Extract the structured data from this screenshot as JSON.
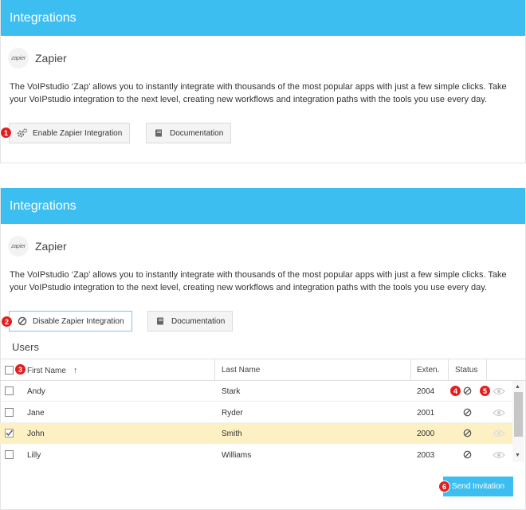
{
  "sections": [
    {
      "header": "Integrations",
      "zapier_logo": "zapier",
      "zapier_name": "Zapier",
      "description": "The VoIPstudio ‘Zap’ allows you to instantly integrate with thousands of the most popular apps with just a few simple clicks. Take your VoIPstudio integration to the next level, creating new workflows and integration paths with the tools you use every day.",
      "toggle_label": "Enable Zapier Integration",
      "toggle_icon": "gears-icon",
      "docs_label": "Documentation",
      "badge": "1"
    },
    {
      "header": "Integrations",
      "zapier_logo": "zapier",
      "zapier_name": "Zapier",
      "description": "The VoIPstudio ‘Zap’ allows you to instantly integrate with thousands of the most popular apps with just a few simple clicks. Take your VoIPstudio integration to the next level, creating new workflows and integration paths with the tools you use every day.",
      "toggle_label": "Disable Zapier Integration",
      "toggle_icon": "ban-icon",
      "docs_label": "Documentation",
      "badge": "2"
    }
  ],
  "users": {
    "title": "Users",
    "columns": {
      "first_name": "First Name",
      "sort_indicator": "↑",
      "last_name": "Last Name",
      "extension": "Exten.",
      "status": "Status"
    },
    "rows": [
      {
        "first": "Andy",
        "last": "Stark",
        "ext": "2004",
        "checked": false
      },
      {
        "first": "Jane",
        "last": "Ryder",
        "ext": "2001",
        "checked": false
      },
      {
        "first": "John",
        "last": "Smith",
        "ext": "2000",
        "checked": true
      },
      {
        "first": "Lilly",
        "last": "Williams",
        "ext": "2003",
        "checked": false
      }
    ],
    "badges": {
      "select_all": "3",
      "status": "4",
      "view": "5"
    },
    "send_invitation": "Send Invitation",
    "send_badge": "6"
  },
  "colors": {
    "header_bg": "#3dbef1",
    "selected_row": "#fdf0c3",
    "badge": "#e02020"
  }
}
